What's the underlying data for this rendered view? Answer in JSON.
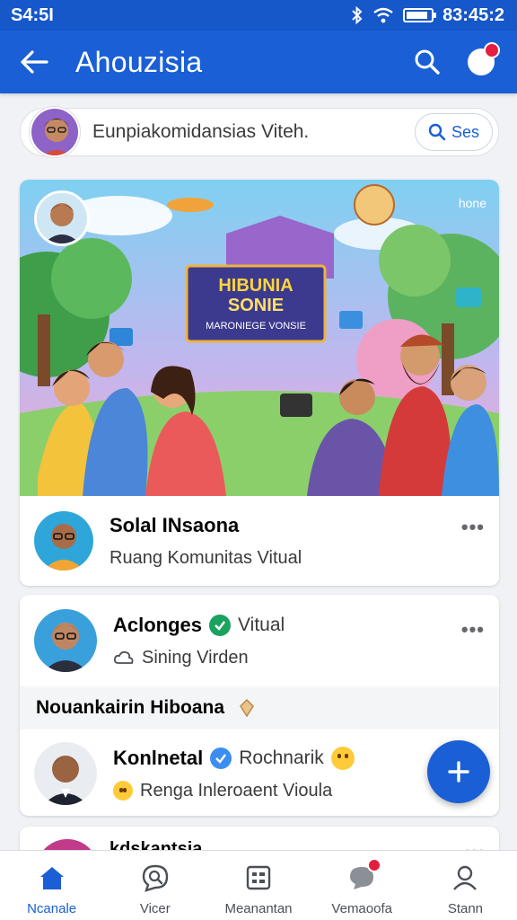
{
  "status_bar": {
    "left": "S4:5I",
    "right": "83:45:2",
    "battery_level": 0.9
  },
  "app_bar": {
    "title": "Ahouzisia"
  },
  "composer": {
    "prompt": "Eunpiakomidansias Viteh.",
    "button_label": "Ses"
  },
  "feature": {
    "banner_line1": "HIBUNIA",
    "banner_line2": "SONIE",
    "banner_line3": "MARONIEGE VONSIE",
    "corner_label": "hone",
    "post_name": "Solal INsaona",
    "post_sub": "Ruang Komunitas Vitual",
    "more": "•••"
  },
  "card2": {
    "post1_name": "Aclonges",
    "post1_extra": "Vitual",
    "post1_sub": "Sining Virden",
    "group_label": "Nouankairin Hiboana",
    "post2_name": "Konlnetal",
    "post2_extra": "Rochnarik",
    "post2_sub": "Renga Inleroaent Vioula",
    "more": "•••"
  },
  "peek": {
    "name": "kdskantsia"
  },
  "bottom_nav": {
    "items": [
      {
        "label": "Ncanale",
        "icon": "home-icon",
        "active": true
      },
      {
        "label": "Vicer",
        "icon": "search-chat-icon",
        "active": false
      },
      {
        "label": "Meanantan",
        "icon": "grid-icon",
        "active": false
      },
      {
        "label": "Vemaoofa",
        "icon": "messages-icon",
        "active": false
      },
      {
        "label": "Stann",
        "icon": "profile-icon",
        "active": false
      }
    ]
  },
  "colors": {
    "primary": "#1a5fd6",
    "notification": "#e41e3f",
    "verified": "#1aa260"
  }
}
